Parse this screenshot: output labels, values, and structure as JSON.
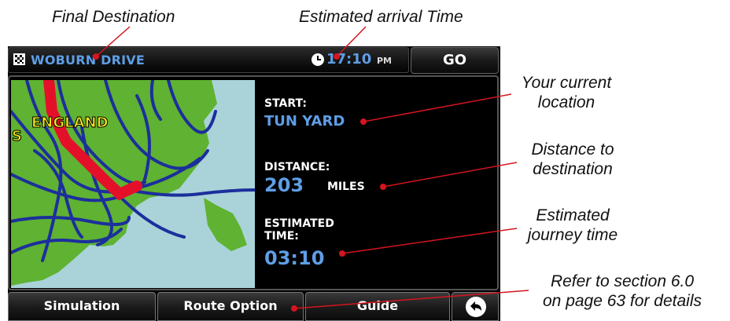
{
  "annotations": {
    "final_destination": "Final Destination",
    "estimated_arrival": "Estimated arrival Time",
    "current_location_1": "Your current",
    "current_location_2": "location",
    "distance_1": "Distance to",
    "distance_2": "destination",
    "journey_time_1": "Estimated",
    "journey_time_2": "journey time",
    "refer_1": "Refer to section 6.0",
    "refer_2": "on page 63 for details"
  },
  "header": {
    "destination": "WOBURN DRIVE",
    "eta_time": "17:10",
    "eta_ampm": "PM",
    "go_label": "GO"
  },
  "map": {
    "region_label": "ENGLAND",
    "edge_label": "S"
  },
  "info": {
    "start_label": "START:",
    "start_value": "TUN YARD",
    "distance_label": "DISTANCE:",
    "distance_value": "203",
    "distance_unit": "MILES",
    "time_label_1": "ESTIMATED",
    "time_label_2": "TIME:",
    "time_value": "03:10"
  },
  "footer": {
    "simulation_label": "Simulation",
    "route_option_label": "Route Option",
    "guide_label": "Guide",
    "back_icon": "back-arrow-icon"
  },
  "colors": {
    "accent_blue": "#5e9ee6",
    "land_green": "#5fb232",
    "sea_blue": "#a9d3d8",
    "road_blue": "#1c2f9c",
    "route_red": "#e4102a",
    "callout_red": "#d4151f"
  }
}
